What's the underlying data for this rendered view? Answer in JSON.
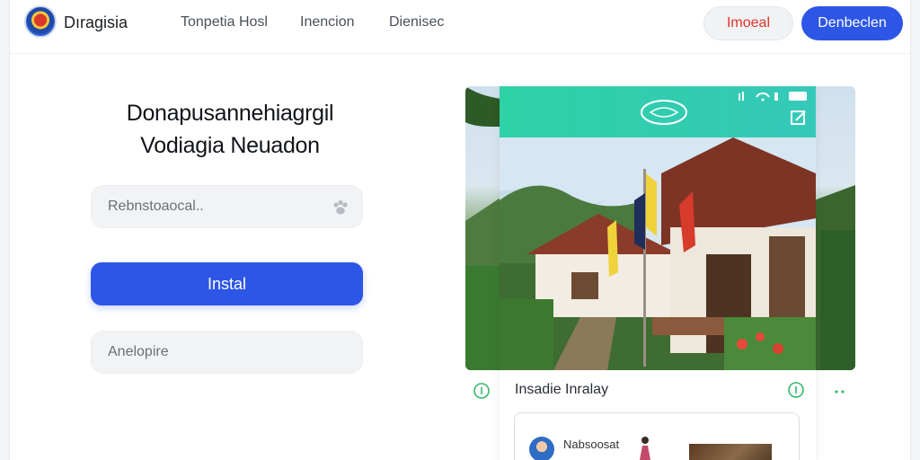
{
  "header": {
    "brand": "Dıragisia",
    "nav": [
      "Tonpetia Hosl",
      "Inencion",
      "Dienisec"
    ],
    "secondary_button": "Imoeal",
    "primary_button": "Denbeclen"
  },
  "form": {
    "headline_line1": "Donapusannehiagrgil",
    "headline_line2": "Vodiagia Neuadon",
    "field1_placeholder": "Rebnstoaocal..",
    "install_button": "Instal",
    "field2_placeholder": "Anelopire"
  },
  "preview": {
    "caption": "Insadie Inralay",
    "card_name": "Nabsoosat",
    "card_sub": "..."
  },
  "colors": {
    "accent": "#2d55e6",
    "danger": "#e0342a",
    "phone_bar": "#2fd1a6"
  }
}
